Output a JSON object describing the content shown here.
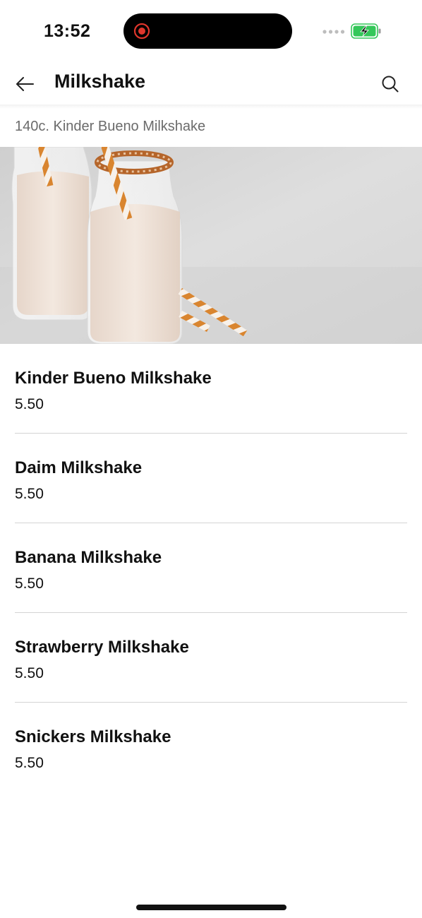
{
  "status_bar": {
    "time": "13:52",
    "recording_icon": "record-icon",
    "signal_icon": "signal-dots-icon",
    "battery_icon": "battery-charging-icon",
    "battery_color": "#34c759"
  },
  "header": {
    "title": "Milkshake",
    "back_icon": "arrow-left-icon",
    "search_icon": "search-icon"
  },
  "section": {
    "heading": "140c. Kinder Bueno Milkshake"
  },
  "items": [
    {
      "name": "Kinder Bueno Milkshake",
      "price": "5.50"
    },
    {
      "name": "Daim Milkshake",
      "price": "5.50"
    },
    {
      "name": "Banana Milkshake",
      "price": "5.50"
    },
    {
      "name": "Strawberry Milkshake",
      "price": "5.50"
    },
    {
      "name": "Snickers Milkshake",
      "price": "5.50"
    }
  ]
}
